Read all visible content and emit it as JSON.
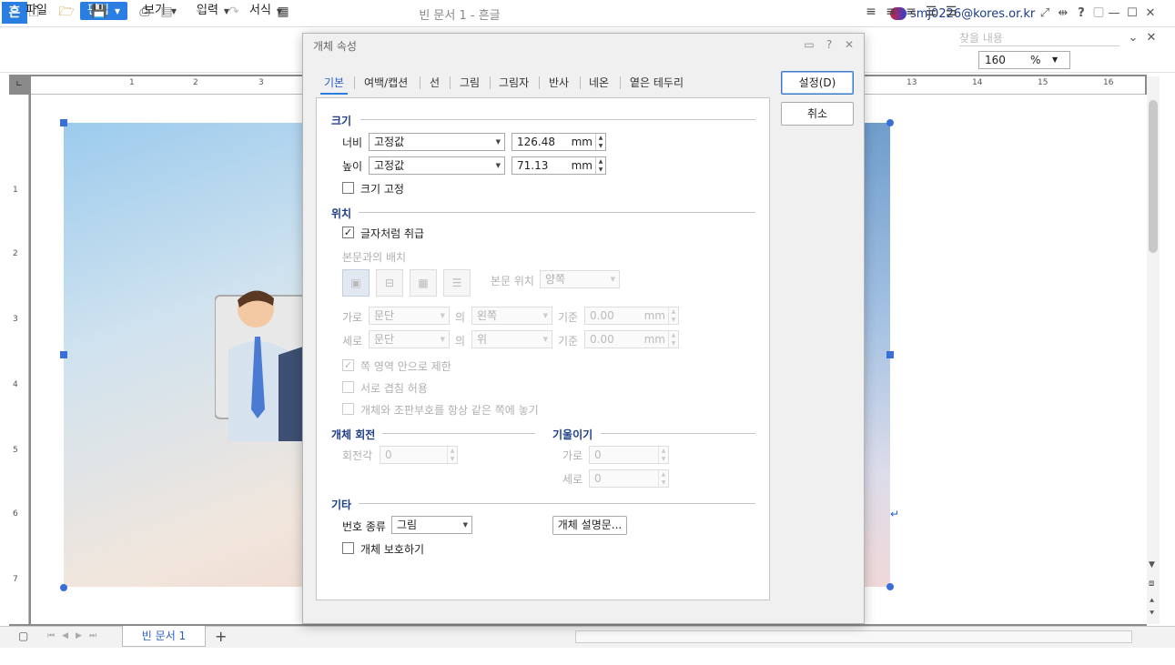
{
  "app": {
    "logo": "흔",
    "title": "빈 문서 1 - 흔글",
    "account": "smj0226@kores.or.kr"
  },
  "titlebar_icons": [
    "fullscreen-icon",
    "resize-icon",
    "help-icon",
    "minimize-icon",
    "maximize-icon",
    "close-icon"
  ],
  "menu": {
    "items": [
      "파일",
      "편집",
      "보기",
      "입력",
      "서식"
    ],
    "search_placeholder": "찾을 내용"
  },
  "toolbar": {
    "zoom_value": "160",
    "zoom_unit": "%"
  },
  "ruler": {
    "top_ticks": [
      "1",
      "2",
      "3",
      "13",
      "14",
      "15",
      "16"
    ],
    "left_ticks": [
      "1",
      "2",
      "3",
      "4",
      "5",
      "6",
      "7"
    ]
  },
  "dialog": {
    "title": "개체 속성",
    "tabs": [
      "기본",
      "여백/캡션",
      "선",
      "그림",
      "그림자",
      "반사",
      "네온",
      "옅은 테두리"
    ],
    "buttons": {
      "ok": "설정(D)",
      "cancel": "취소"
    },
    "size": {
      "section": "크기",
      "width_label": "너비",
      "width_mode": "고정값",
      "width_value": "126.48",
      "width_unit": "mm",
      "height_label": "높이",
      "height_mode": "고정값",
      "height_value": "71.13",
      "height_unit": "mm",
      "lock_label": "크기 고정",
      "lock_checked": false
    },
    "position": {
      "section": "위치",
      "treat_as_char": "글자처럼 취급",
      "treat_as_char_checked": true,
      "wrap_label": "본문과의 배치",
      "text_pos_label": "본문 위치",
      "text_pos_value": "양쪽",
      "horiz_label": "가로",
      "horiz_ref": "문단",
      "horiz_of": "의",
      "horiz_align": "왼쪽",
      "horiz_base": "기준",
      "horiz_value": "0.00",
      "horiz_unit": "mm",
      "vert_label": "세로",
      "vert_ref": "문단",
      "vert_of": "의",
      "vert_align": "위",
      "vert_base": "기준",
      "vert_value": "0.00",
      "vert_unit": "mm",
      "opt1": "쪽 영역 안으로 제한",
      "opt1_checked": true,
      "opt2": "서로 겹침 허용",
      "opt3": "개체와 조판부호를 항상 같은 쪽에 놓기"
    },
    "rotation": {
      "section": "개체 회전",
      "angle_label": "회전각",
      "angle_value": "0"
    },
    "skew": {
      "section": "기울이기",
      "horiz_label": "가로",
      "horiz_value": "0",
      "vert_label": "세로",
      "vert_value": "0"
    },
    "etc": {
      "section": "기타",
      "number_type_label": "번호 종류",
      "number_type_value": "그림",
      "desc_button": "개체 설명문...",
      "protect_label": "개체 보호하기"
    }
  },
  "bottom": {
    "doc_tab": "빈 문서 1",
    "add_tab": "+"
  }
}
